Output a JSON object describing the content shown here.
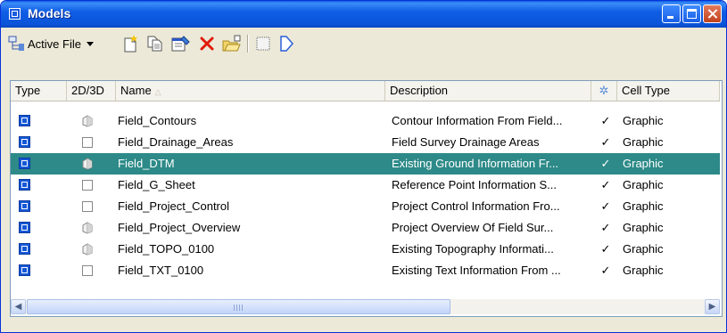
{
  "window": {
    "title": "Models"
  },
  "toolbar": {
    "active_file_label": "Active File",
    "icons": [
      "tree-icon",
      "dropdown-arrow-icon",
      "new-model-icon",
      "copy-model-icon",
      "properties-icon",
      "delete-icon",
      "import-icon",
      "select-icon",
      "shape-icon"
    ]
  },
  "columns": [
    "Type",
    "2D/3D",
    "Name",
    "Description",
    "✲",
    "Cell Type"
  ],
  "colors": {
    "selected_row": "#2d8a88",
    "title_bar": "#0a54d8",
    "type_icon": "#1558d6"
  },
  "rows": [
    {
      "dim": "3D",
      "name": "Field_Contours",
      "description": "Contour Information From Field...",
      "check": "✓",
      "cell_type": "Graphic"
    },
    {
      "dim": "2D",
      "name": "Field_Drainage_Areas",
      "description": "Field Survey Drainage Areas",
      "check": "✓",
      "cell_type": "Graphic"
    },
    {
      "dim": "3D",
      "name": "Field_DTM",
      "description": "Existing Ground Information Fr...",
      "check": "✓",
      "cell_type": "Graphic",
      "selected": true
    },
    {
      "dim": "2D",
      "name": "Field_G_Sheet",
      "description": "Reference Point Information S...",
      "check": "✓",
      "cell_type": "Graphic"
    },
    {
      "dim": "2D",
      "name": "Field_Project_Control",
      "description": "Project Control Information Fro...",
      "check": "✓",
      "cell_type": "Graphic"
    },
    {
      "dim": "3D",
      "name": "Field_Project_Overview",
      "description": "Project Overview Of Field Sur...",
      "check": "✓",
      "cell_type": "Graphic"
    },
    {
      "dim": "3D",
      "name": "Field_TOPO_0100",
      "description": "Existing Topography Informati...",
      "check": "✓",
      "cell_type": "Graphic"
    },
    {
      "dim": "2D",
      "name": "Field_TXT_0100",
      "description": "Existing Text Information From ...",
      "check": "✓",
      "cell_type": "Graphic"
    }
  ]
}
